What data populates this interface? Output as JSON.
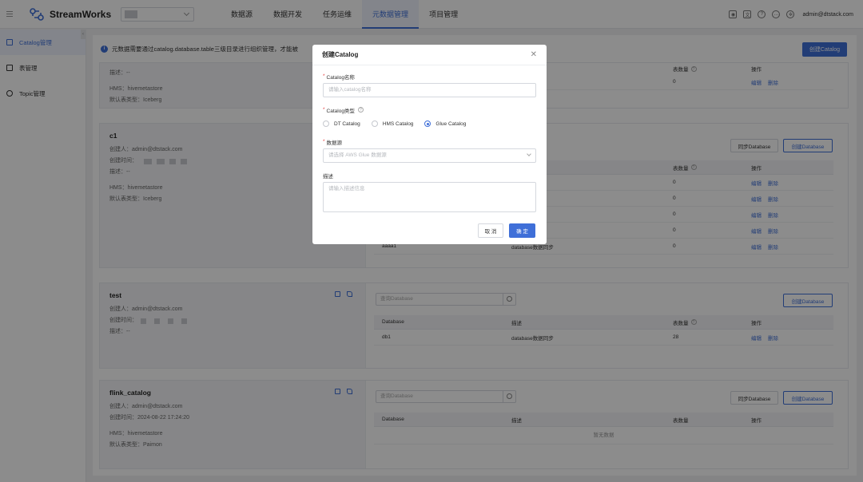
{
  "app": {
    "name": "StreamWorks"
  },
  "nav": [
    "数据源",
    "数据开发",
    "任务运维",
    "元数据管理",
    "项目管理"
  ],
  "user": "admin@dtstack.com",
  "colors": {
    "accent": "#3f6fd8",
    "danger": "#e54545"
  },
  "sidebar": {
    "items": [
      {
        "label": "Catalog管理",
        "icon": "catalog-icon"
      },
      {
        "label": "表管理",
        "icon": "table-icon"
      },
      {
        "label": "Topic管理",
        "icon": "topic-icon"
      }
    ]
  },
  "main": {
    "info_text": "元数据需要通过catalog.database.table三级目录进行组织管理，才能被",
    "create_catalog": "创建Catalog"
  },
  "labels": {
    "search_placeholder": "查询Database",
    "sync_db": "同步Database",
    "create_db": "创建Database",
    "col_db": "Database",
    "col_desc": "描述",
    "col_count": "表数量",
    "col_action": "操作",
    "edit": "编辑",
    "delete": "删除",
    "empty": "暂无数据",
    "creator": "创建人：",
    "created_at": "创建时间：",
    "desc": "描述：",
    "hms": "HMS：",
    "default_type": "默认表类型："
  },
  "cards": [
    {
      "desc": "--",
      "hms": "hivemetastore",
      "default_type": "Iceberg",
      "rows": [
        {
          "desc": "据同步",
          "count": "0"
        }
      ]
    },
    {
      "name": "c1",
      "creator": "admin@dtstack.com",
      "desc": "--",
      "hms": "hivemetastore",
      "default_type": "Iceberg",
      "rows": [
        {
          "db": "",
          "desc": "据同步",
          "count": "0"
        },
        {
          "db": "",
          "desc": "据同步",
          "count": "0"
        },
        {
          "db": "",
          "desc": "据同步",
          "count": "0"
        },
        {
          "db": "",
          "desc": "据同步",
          "count": "0"
        },
        {
          "db": "aaaa1",
          "desc": "database数据同步",
          "count": "0"
        }
      ]
    },
    {
      "name": "test",
      "creator": "admin@dtstack.com",
      "desc": "--",
      "rows": [
        {
          "db": "db1",
          "desc": "database数据同步",
          "count": "28"
        }
      ]
    },
    {
      "name": "flink_catalog",
      "creator": "admin@dtstack.com",
      "created_at": "2024-08-22 17:24:20",
      "hms": "hivemetastore",
      "default_type": "Paimon"
    }
  ],
  "modal": {
    "title": "创建Catalog",
    "name_label": "Catalog名称",
    "name_placeholder": "请输入catalog名称",
    "type_label": "Catalog类型",
    "types": [
      "DT Catalog",
      "HMS Catalog",
      "Glue Catalog"
    ],
    "selected_type": "Glue Catalog",
    "source_label": "数据源",
    "source_placeholder": "请选择 AWS Glue 数据源",
    "desc_label": "描述",
    "desc_placeholder": "请输入描述信息",
    "cancel": "取 消",
    "ok": "确 定"
  }
}
